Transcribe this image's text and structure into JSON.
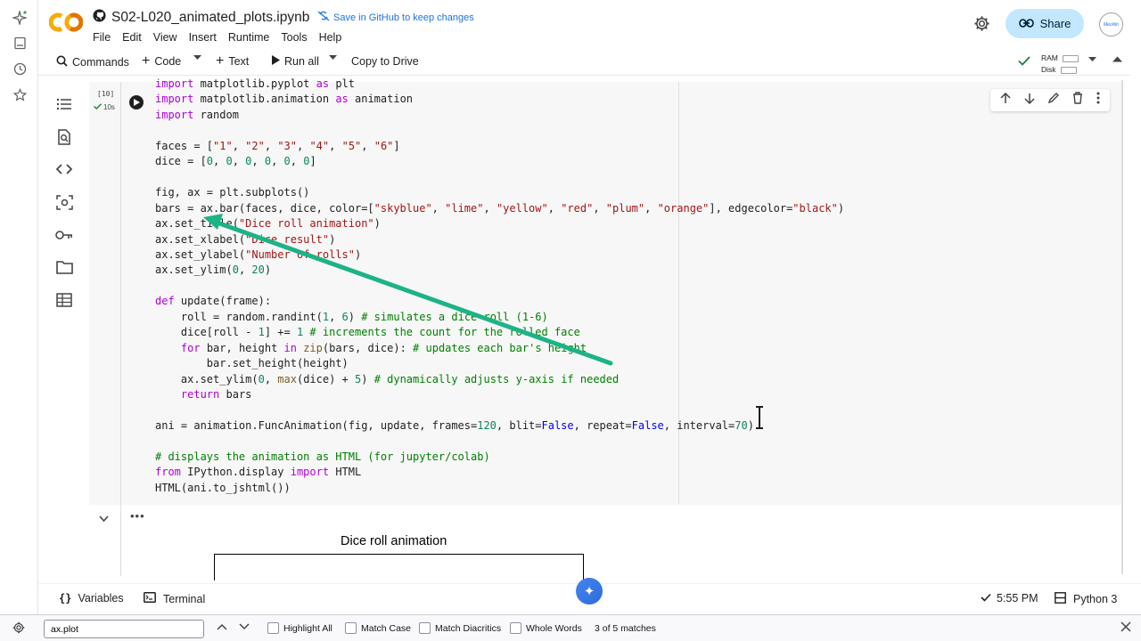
{
  "header": {
    "notebook_title": "S02-L020_animated_plots.ipynb",
    "save_link": "Save in GitHub to keep changes",
    "share_label": "Share",
    "avatar_text": "Mecklin"
  },
  "menu": [
    "File",
    "Edit",
    "View",
    "Insert",
    "Runtime",
    "Tools",
    "Help"
  ],
  "toolbar": {
    "commands": "Commands",
    "code": "Code",
    "text": "Text",
    "run_all": "Run all",
    "copy_to_drive": "Copy to Drive",
    "ram_label": "RAM",
    "disk_label": "Disk"
  },
  "cell": {
    "exec_count": "[10]",
    "exec_time": "10s",
    "code_lines": [
      "import matplotlib.pyplot as plt",
      "import matplotlib.animation as animation",
      "import random",
      "",
      "faces = [\"1\", \"2\", \"3\", \"4\", \"5\", \"6\"]",
      "dice = [0, 0, 0, 0, 0, 0]",
      "",
      "fig, ax = plt.subplots()",
      "bars = ax.bar(faces, dice, color=[\"skyblue\", \"lime\", \"yellow\", \"red\", \"plum\", \"orange\"], edgecolor=\"black\")",
      "ax.set_title(\"Dice roll animation\")",
      "ax.set_xlabel(\"Dice result\")",
      "ax.set_ylabel(\"Number of rolls\")",
      "ax.set_ylim(0, 20)",
      "",
      "def update(frame):",
      "    roll = random.randint(1, 6) # simulates a dice roll (1-6)",
      "    dice[roll - 1] += 1 # increments the count for the rolled face",
      "    for bar, height in zip(bars, dice): # updates each bar's height",
      "        bar.set_height(height)",
      "    ax.set_ylim(0, max(dice) + 5) # dynamically adjusts y-axis if needed",
      "    return bars",
      "",
      "ani = animation.FuncAnimation(fig, update, frames=120, blit=False, repeat=False, interval=70)",
      "",
      "# displays the animation as HTML (for jupyter/colab)",
      "from IPython.display import HTML",
      "HTML(ani.to_jshtml())"
    ]
  },
  "output": {
    "plot_title": "Dice roll animation"
  },
  "statusbar": {
    "variables": "Variables",
    "terminal": "Terminal",
    "time": "5:55 PM",
    "runtime": "Python 3"
  },
  "findbar": {
    "query": "ax.plot",
    "highlight_all": "Highlight All",
    "match_case": "Match Case",
    "match_diacritics": "Match Diacritics",
    "whole_words": "Whole Words",
    "match_count": "3 of 5 matches"
  },
  "colors": {
    "accent": "#1a73e8",
    "share_bg": "#c2e7ff",
    "annotation_arrow": "#1db386",
    "check_green": "#188038"
  }
}
